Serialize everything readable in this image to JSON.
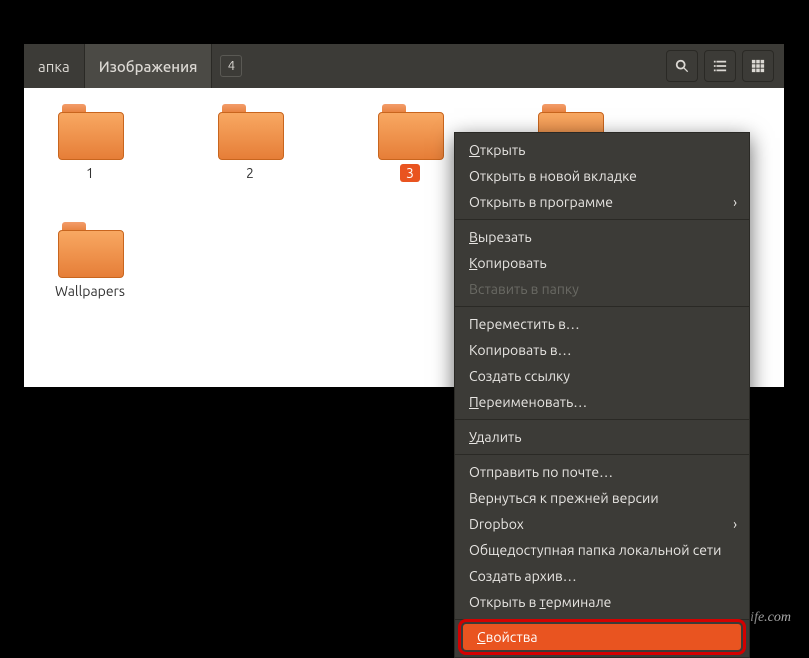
{
  "toolbar": {
    "path_prev": "апка",
    "path_current": "Изображения",
    "count": "4"
  },
  "folders": [
    {
      "name": "1",
      "sel": false
    },
    {
      "name": "2",
      "sel": false
    },
    {
      "name": "3",
      "sel": true
    },
    {
      "name": "",
      "sel": false
    },
    {
      "name": "Wallpapers",
      "sel": false
    }
  ],
  "menu": {
    "open": "Открыть",
    "open_tab": "Открыть в новой вкладке",
    "open_with": "Открыть в программе",
    "cut": "Вырезать",
    "copy": "Копировать",
    "paste": "Вставить в папку",
    "move": "Переместить в…",
    "copy_to": "Копировать в…",
    "link": "Создать ссылку",
    "rename": "Переименовать…",
    "delete": "Удалить",
    "sendmail": "Отправить по почте…",
    "revert": "Вернуться к прежней версии",
    "dropbox": "Dropbox",
    "lanshare": "Общедоступная папка локальной сети",
    "archive": "Создать архив…",
    "terminal": "Открыть в терминале",
    "props": "Свойства"
  },
  "watermark": "user-life.com"
}
